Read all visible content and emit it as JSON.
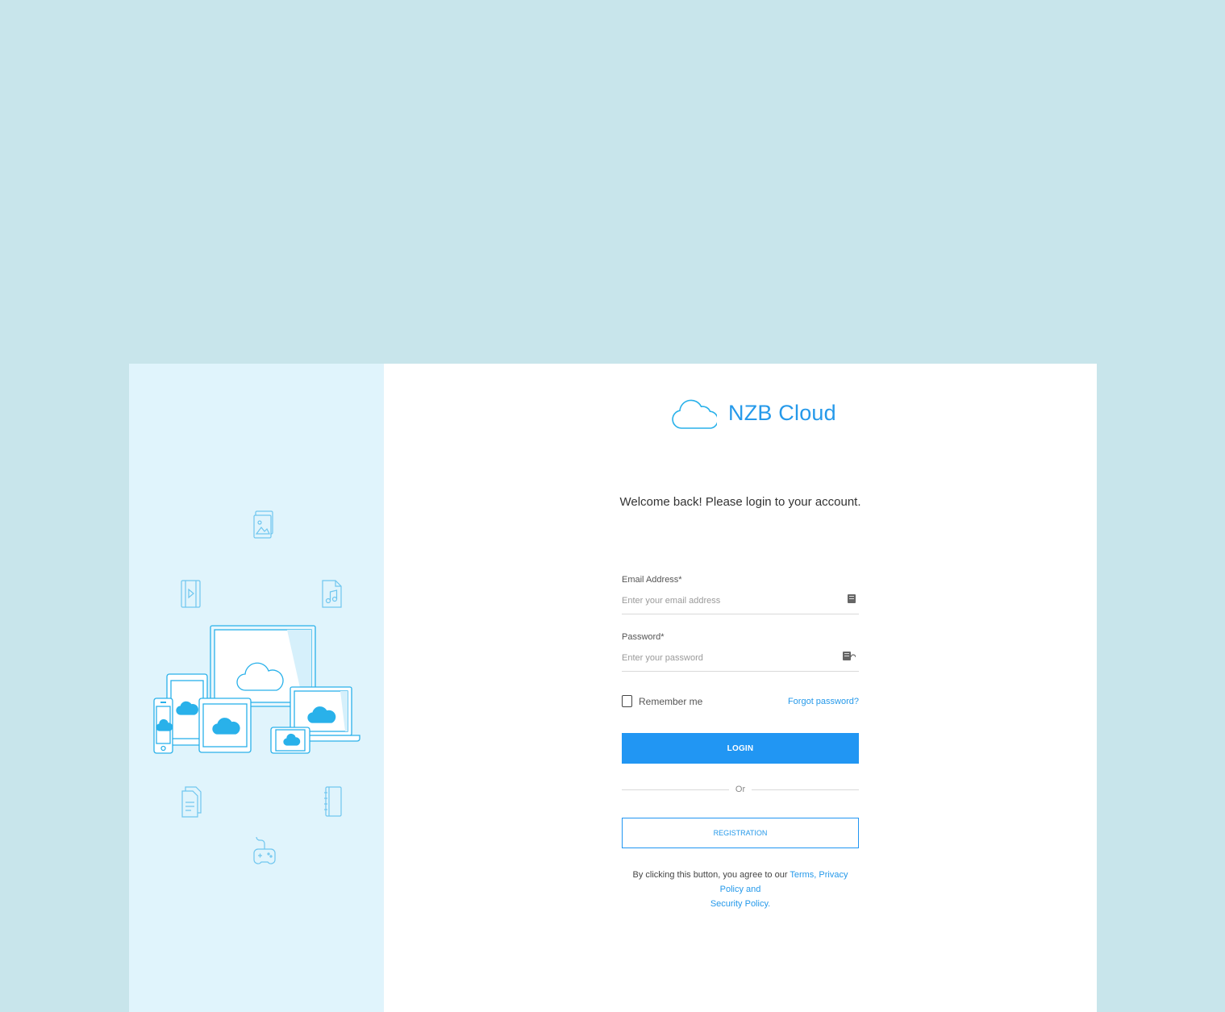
{
  "brand": {
    "name": "NZB Cloud",
    "icon": "cloud-icon",
    "color": "#2599ea"
  },
  "welcome_text": "Welcome back! Please login to your account.",
  "form": {
    "email_label": "Email Address*",
    "email_placeholder": "Enter your email address",
    "email_icon": "email-card-icon",
    "password_label": "Password*",
    "password_placeholder": "Enter your password",
    "password_icon": "password-key-icon",
    "remember_label": "Remember me",
    "remember_checked": false,
    "forgot_label": "Forgot password?",
    "login_label": "LOGIN",
    "or_label": "Or",
    "register_label": "REGISTRATION",
    "terms_prefix": "By clicking this button, you agree to our ",
    "terms_link_terms": "Terms,",
    "terms_link_privacy": " Privacy Policy and",
    "terms_link_security": "Security Policy."
  },
  "illustration": {
    "icons": [
      "image-file-icon",
      "video-file-icon",
      "music-file-icon",
      "document-file-icon",
      "notebook-icon",
      "gamepad-icon",
      "devices-cloud-icon"
    ]
  },
  "colors": {
    "background": "#c8e5eb",
    "left_panel": "#e0f4fc",
    "accent": "#2196f3"
  }
}
